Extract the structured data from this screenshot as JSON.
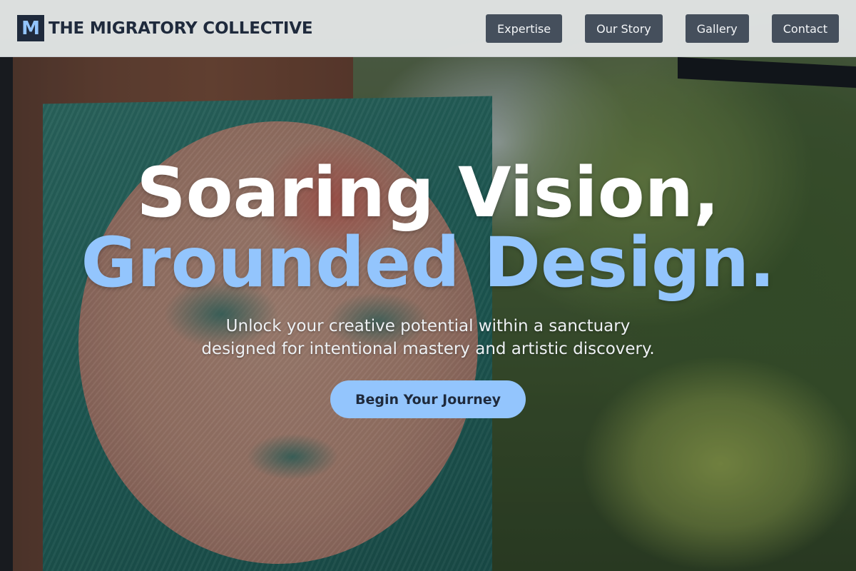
{
  "brand": {
    "mark": "M",
    "name": "THE MIGRATORY COLLECTIVE"
  },
  "nav": {
    "items": [
      {
        "label": "Expertise"
      },
      {
        "label": "Our Story"
      },
      {
        "label": "Gallery"
      },
      {
        "label": "Contact"
      }
    ]
  },
  "hero": {
    "headline_line1": "Soaring Vision,",
    "headline_line2": "Grounded Design.",
    "subtitle_line1": "Unlock your creative potential within a sanctuary",
    "subtitle_line2": "designed for intentional mastery and artistic discovery.",
    "cta_label": "Begin Your Journey"
  },
  "colors": {
    "accent": "#93c5fd",
    "brand_dark": "#1f2a3c",
    "nav_button": "#454f5c"
  }
}
